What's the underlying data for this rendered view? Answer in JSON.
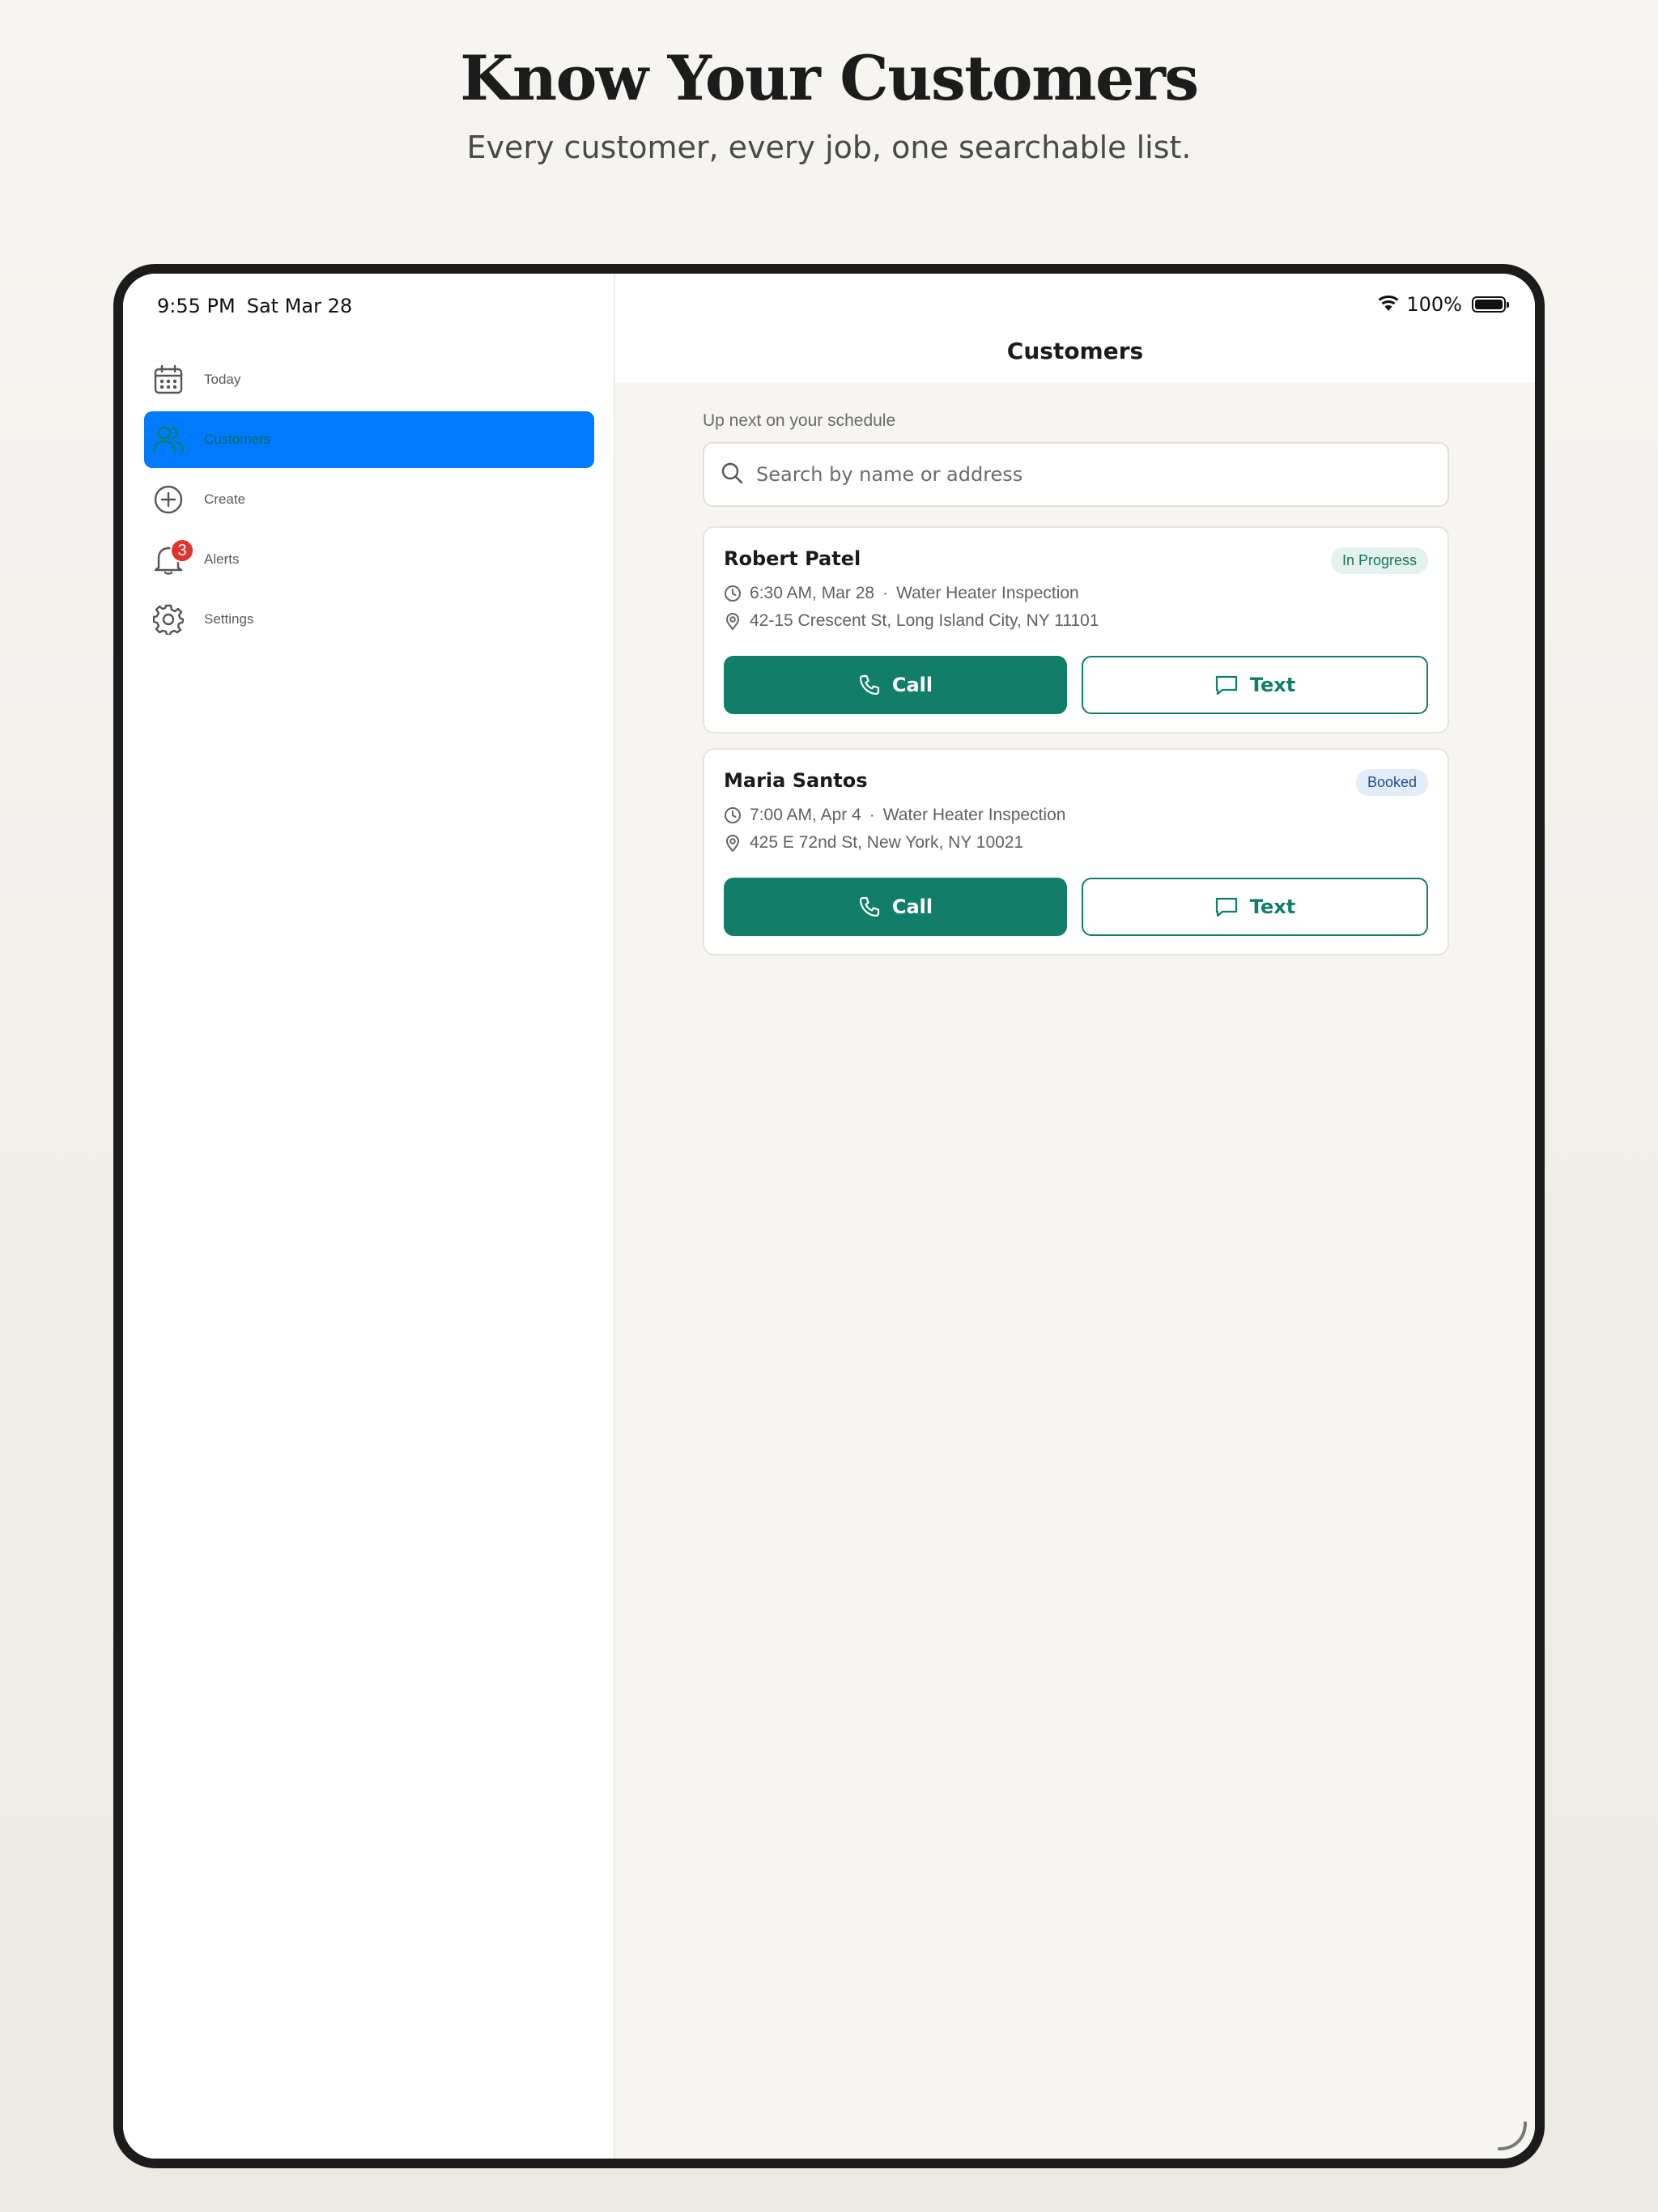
{
  "marketing": {
    "headline": "Know Your Customers",
    "subhead": "Every customer, every job, one searchable list."
  },
  "status_bar": {
    "time": "9:55 PM",
    "date": "Sat Mar 28",
    "battery": "100%",
    "battery_level": 1.0
  },
  "sidebar": {
    "items": [
      {
        "label": "Today",
        "icon": "calendar-icon"
      },
      {
        "label": "Customers",
        "icon": "people-icon",
        "active": true
      },
      {
        "label": "Create",
        "icon": "plus-circle-icon"
      },
      {
        "label": "Alerts",
        "icon": "bell-icon",
        "badge": "3"
      },
      {
        "label": "Settings",
        "icon": "gear-icon"
      }
    ]
  },
  "main": {
    "title": "Customers",
    "section_label": "Up next on your schedule",
    "search": {
      "placeholder": "Search by name or address",
      "value": ""
    },
    "customers": [
      {
        "name": "Robert Patel",
        "status": "In Progress",
        "time": "6:30 AM, Mar 28",
        "job": "Water Heater Inspection",
        "address": "42-15 Crescent St, Long Island City, NY 11101",
        "call_label": "Call",
        "text_label": "Text"
      },
      {
        "name": "Maria Santos",
        "status": "Booked",
        "time": "7:00 AM, Apr 4",
        "job": "Water Heater Inspection",
        "address": "425 E 72nd St, New York, NY 10021",
        "call_label": "Call",
        "text_label": "Text"
      }
    ]
  },
  "colors": {
    "accent": "#107e68",
    "active_nav": "#007aff",
    "badge": "#e0342f",
    "in_progress_bg": "#e3f2ec",
    "booked_bg": "#e2ecfb"
  }
}
